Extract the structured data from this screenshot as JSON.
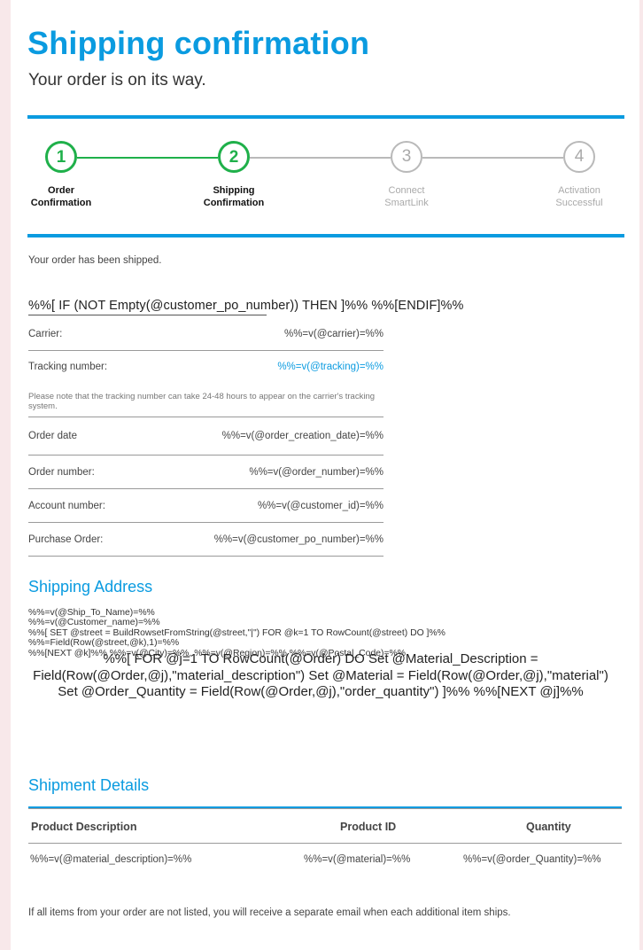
{
  "header": {
    "title": "Shipping confirmation",
    "subtitle": "Your order is on its way."
  },
  "colors": {
    "accent": "#0a9be0",
    "step_done": "#1fb04a",
    "step_todo": "#b9b9b9",
    "background": "#f8e8ea"
  },
  "steps": [
    {
      "number": "1",
      "label": "Order\nConfirmation",
      "done": true
    },
    {
      "number": "2",
      "label": "Shipping\nConfirmation",
      "done": true
    },
    {
      "number": "3",
      "label": "Connect\nSmartLink",
      "done": false
    },
    {
      "number": "4",
      "label": "Activation\nSuccessful",
      "done": false
    }
  ],
  "intro": "Your order has been shipped.",
  "po_conditional": "%%[ IF (NOT Empty(@customer_po_number)) THEN ]%% %%[ENDIF]%%",
  "details": {
    "carrier": {
      "label": "Carrier:",
      "value": "%%=v(@carrier)=%%"
    },
    "tracking": {
      "label": "Tracking number:",
      "value": "%%=v(@tracking)=%%",
      "note": "Please note that the tracking number can take 24-48 hours to appear on the carrier's tracking system."
    },
    "order_date": {
      "label": "Order date",
      "value": "%%=v(@order_creation_date)=%%"
    },
    "order_number": {
      "label": "Order number:",
      "value": "%%=v(@order_number)=%%"
    },
    "account_number": {
      "label": "Account number:",
      "value": "%%=v(@customer_id)=%%"
    },
    "purchase_order": {
      "label": "Purchase Order:",
      "value": "%%=v(@customer_po_number)=%%"
    }
  },
  "shipping_address": {
    "heading": "Shipping Address",
    "lines": [
      "%%=v(@Ship_To_Name)=%%",
      "%%=v(@Customer_name)=%%",
      "%%[ SET @street = BuildRowsetFromString(@street,\"|\") FOR @k=1 TO RowCount(@street) DO ]%%",
      "%%=Field(Row(@street,@k),1)=%%",
      "%%[NEXT @k]%% %%=v(@City)=%%, %%=v(@Region)=%% %%=v(@Postal_Code)=%%"
    ],
    "loop_script": "%%[ FOR @j=1 TO RowCount(@Order) DO Set @Material_Description = Field(Row(@Order,@j),\"material_description\") Set @Material = Field(Row(@Order,@j),\"material\") Set @Order_Quantity = Field(Row(@Order,@j),\"order_quantity\") ]%% %%[NEXT @j]%%"
  },
  "shipment_details": {
    "heading": "Shipment Details",
    "columns": [
      "Product Description",
      "Product ID",
      "Quantity"
    ],
    "rows": [
      [
        "%%=v(@material_description)=%%",
        "%%=v(@material)=%%",
        "%%=v(@order_Quantity)=%%"
      ]
    ]
  },
  "footer_note": "If all items from your order are not listed, you will receive a separate email when each additional item ships."
}
